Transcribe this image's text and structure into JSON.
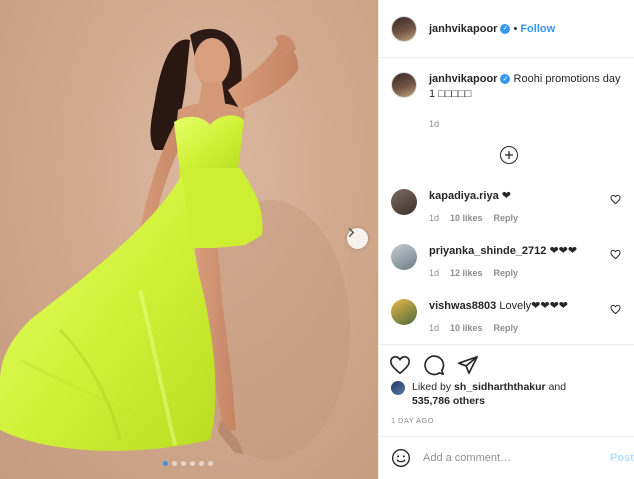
{
  "post": {
    "username": "janhvikapoor",
    "verified": true,
    "follow_label": "Follow",
    "separator": "•",
    "caption": "Roohi promotions day 1 □□□□□",
    "caption_time": "1d",
    "carousel_slides": 6,
    "carousel_active": 1
  },
  "comments": [
    {
      "username": "kapadiya.riya",
      "text": "❤",
      "time": "1d",
      "likes": "10 likes",
      "reply": "Reply"
    },
    {
      "username": "priyanka_shinde_2712",
      "text": "❤❤❤",
      "time": "1d",
      "likes": "12 likes",
      "reply": "Reply"
    },
    {
      "username": "vishwas8803",
      "text": "Lovely❤❤❤❤",
      "time": "1d",
      "likes": "10 likes",
      "reply": "Reply"
    }
  ],
  "likes": {
    "prefix": "Liked by",
    "by_user": "sh_sidharththakur",
    "and": "and",
    "others": "535,786 others"
  },
  "time_ago": "1 DAY AGO",
  "add_comment": {
    "placeholder": "Add a comment…",
    "post_label": "Post"
  },
  "icons": {
    "like": "heart-icon",
    "comment": "comment-icon",
    "share": "share-icon",
    "emoji": "emoji-icon",
    "more": "plus-circle-icon",
    "next": "chevron-right-icon"
  },
  "colors": {
    "accent": "#3897f0",
    "post_disabled": "#b2dffc",
    "dress": "#d6f53c",
    "background": "#d2a98d"
  }
}
